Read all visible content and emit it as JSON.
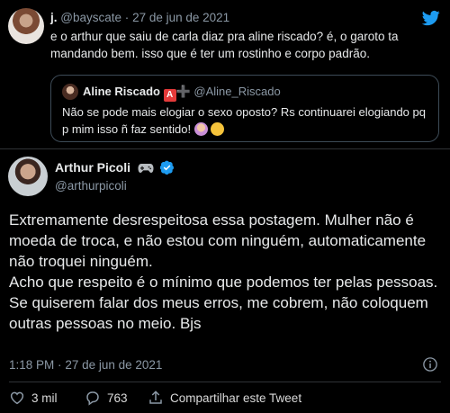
{
  "quoted_tweet": {
    "name": "j.",
    "handle": "@bayscate",
    "separator": "·",
    "date": "27 de jun de 2021",
    "text": "e o arthur que saiu de carla diaz pra aline riscado? é, o garoto ta mandando bem. isso que é ter um rostinho e corpo padrão.",
    "nested_quote": {
      "name": "Aline Riscado",
      "badge_letter": "A",
      "badge_plus": "➕",
      "handle": "@Aline_Riscado",
      "text": "Não se pode mais elogiar o sexo oposto? Rs continuarei elogiando pq p mim isso ñ faz sentido!"
    }
  },
  "main_tweet": {
    "name": "Arthur Picoli",
    "handle": "@arthurpicoli",
    "paragraphs": [
      "Extremamente desrespeitosa essa postagem. Mulher não é moeda de troca, e não estou com ninguém, automaticamente não troquei ninguém.",
      "Acho que respeito é o mínimo que podemos ter pelas pessoas.",
      "Se quiserem falar dos meus erros, me cobrem, não coloquem outras pessoas no meio. Bjs"
    ],
    "time": "1:18 PM",
    "separator": "·",
    "date": "27 de jun de 2021"
  },
  "actions": {
    "likes": "3 mil",
    "replies": "763",
    "share_label": "Compartilhar este Tweet"
  },
  "icons": {
    "brand": "twitter-bird-icon",
    "verified": "verified-badge-icon",
    "like": "heart-icon",
    "reply": "reply-icon",
    "share": "share-icon",
    "info": "info-icon",
    "game": "game-controller-icon"
  },
  "colors": {
    "background": "#000000",
    "twitter_blue": "#1d9bf0",
    "muted_text": "#8b98a5",
    "text": "#e7e9ea"
  }
}
